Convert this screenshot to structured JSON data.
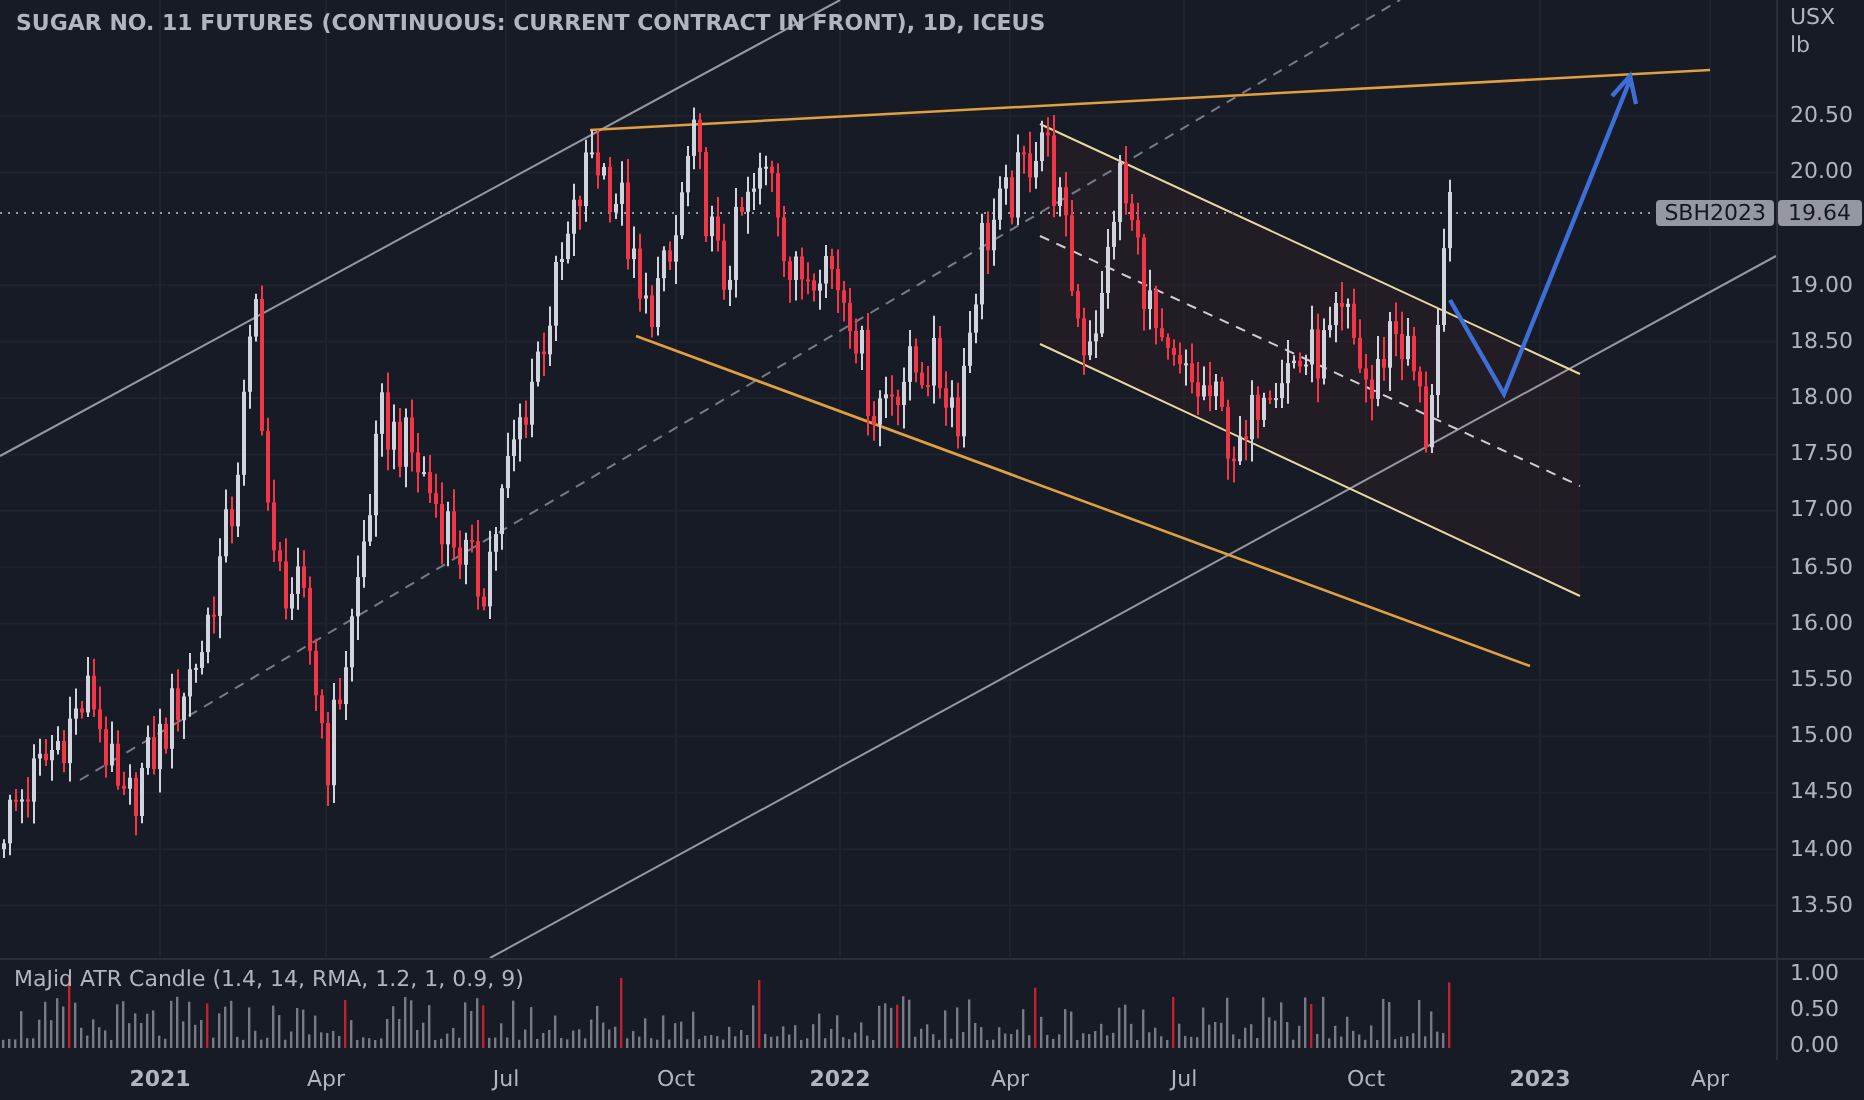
{
  "chart_title": "SUGAR NO. 11 FUTURES (CONTINUOUS: CURRENT CONTRACT IN FRONT), 1D, ICEUS",
  "price_axis": {
    "unit": [
      "USX",
      "lb"
    ],
    "ticks": [
      "20.50",
      "20.00",
      "19.00",
      "18.50",
      "18.00",
      "17.50",
      "17.00",
      "16.50",
      "16.00",
      "15.50",
      "15.00",
      "14.50",
      "14.00",
      "13.50"
    ],
    "symbol_label": "SBH2023",
    "last_price": "19.64"
  },
  "indicator": {
    "title": "MaJid ATR Candle (1.4, 14, RMA, 1.2, 1, 0.9, 9)",
    "ticks": [
      "1.00",
      "0.50",
      "0.00"
    ]
  },
  "time_axis": [
    {
      "label": "2021",
      "kind": "year"
    },
    {
      "label": "Apr",
      "kind": "month"
    },
    {
      "label": "Jul",
      "kind": "month"
    },
    {
      "label": "Oct",
      "kind": "month"
    },
    {
      "label": "2022",
      "kind": "year"
    },
    {
      "label": "Apr",
      "kind": "month"
    },
    {
      "label": "Jul",
      "kind": "month"
    },
    {
      "label": "Oct",
      "kind": "month"
    },
    {
      "label": "2023",
      "kind": "year"
    },
    {
      "label": "Apr",
      "kind": "month"
    }
  ]
}
